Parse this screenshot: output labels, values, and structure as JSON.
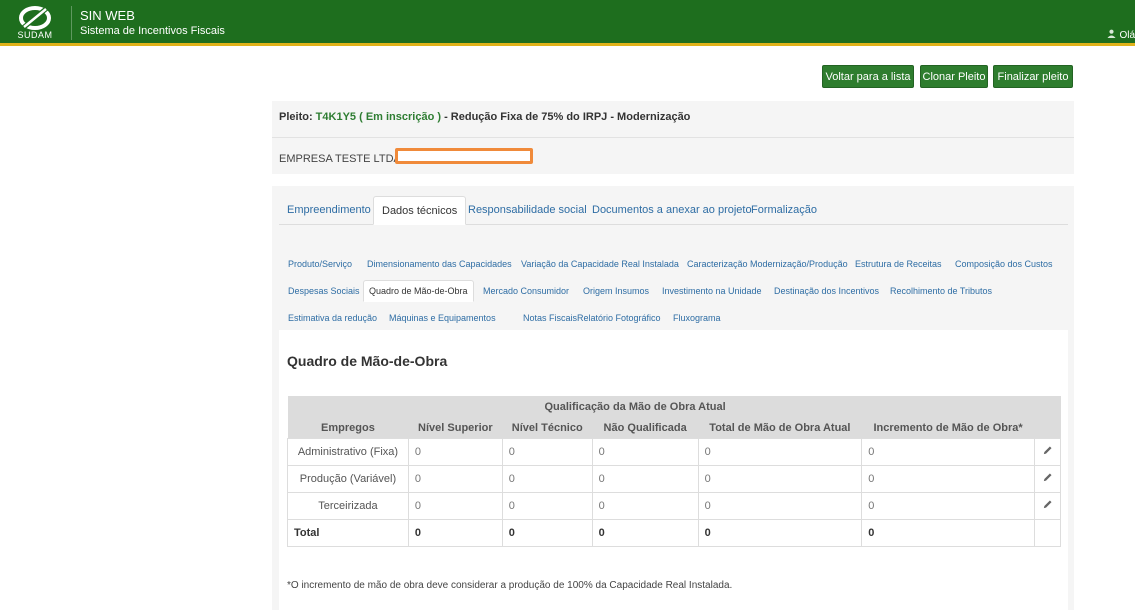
{
  "header": {
    "logo_text": "SUDAM",
    "app_title": "SIN WEB",
    "app_subtitle": "Sistema de Incentivos Fiscais",
    "user_text": "Olá",
    "colors": {
      "bar": "#1e6e1e",
      "accent": "#e0b21a"
    }
  },
  "actions": {
    "back": "Voltar para a lista",
    "clone": "Clonar Pleito",
    "finalize": "Finalizar pleito"
  },
  "pleito": {
    "label": "Pleito: ",
    "code": "T4K1Y5",
    "status": "( Em inscrição )",
    "description": " - Redução Fixa de 75% do IRPJ - Modernização",
    "empresa": "EMPRESA TESTE LTDA -"
  },
  "tabs": [
    {
      "label": "Empreendimento",
      "active": false
    },
    {
      "label": "Dados técnicos",
      "active": true
    },
    {
      "label": "Responsabilidade social",
      "active": false
    },
    {
      "label": "Documentos a anexar ao projeto",
      "active": false
    },
    {
      "label": "Formalização",
      "active": false
    }
  ],
  "subtabs": {
    "row1": [
      "Produto/Serviço",
      "Dimensionamento das Capacidades",
      "Variação da Capacidade Real Instalada",
      "Caracterização Modernização/Produção",
      "Estrutura de Receitas",
      "Composição dos Custos"
    ],
    "row2": [
      "Despesas Sociais",
      "Quadro de Mão-de-Obra",
      "Mercado Consumidor",
      "Origem Insumos",
      "Investimento na Unidade",
      "Destinação dos Incentivos",
      "Recolhimento de Tributos"
    ],
    "row3": [
      "Estimativa da redução",
      "Máquinas e Equipamentos",
      "Notas Fiscais",
      "Relatório Fotográfico",
      "Fluxograma"
    ],
    "active": "Quadro de Mão-de-Obra"
  },
  "content": {
    "title": "Quadro de Mão-de-Obra",
    "group_header": "Qualificação da Mão de Obra Atual",
    "columns": [
      "Empregos",
      "Nível Superior",
      "Nível Técnico",
      "Não Qualificada",
      "Total de Mão de Obra Atual",
      "Incremento de Mão de Obra*"
    ],
    "rows": [
      {
        "label": "Administrativo (Fixa)",
        "values": [
          "0",
          "0",
          "0",
          "0",
          "0"
        ]
      },
      {
        "label": "Produção (Variável)",
        "values": [
          "0",
          "0",
          "0",
          "0",
          "0"
        ]
      },
      {
        "label": "Terceirizada",
        "values": [
          "0",
          "0",
          "0",
          "0",
          "0"
        ]
      }
    ],
    "total": {
      "label": "Total",
      "values": [
        "0",
        "0",
        "0",
        "0",
        "0"
      ]
    },
    "footnote": "*O incremento de mão de obra deve considerar a produção de 100% da Capacidade Real Instalada."
  }
}
